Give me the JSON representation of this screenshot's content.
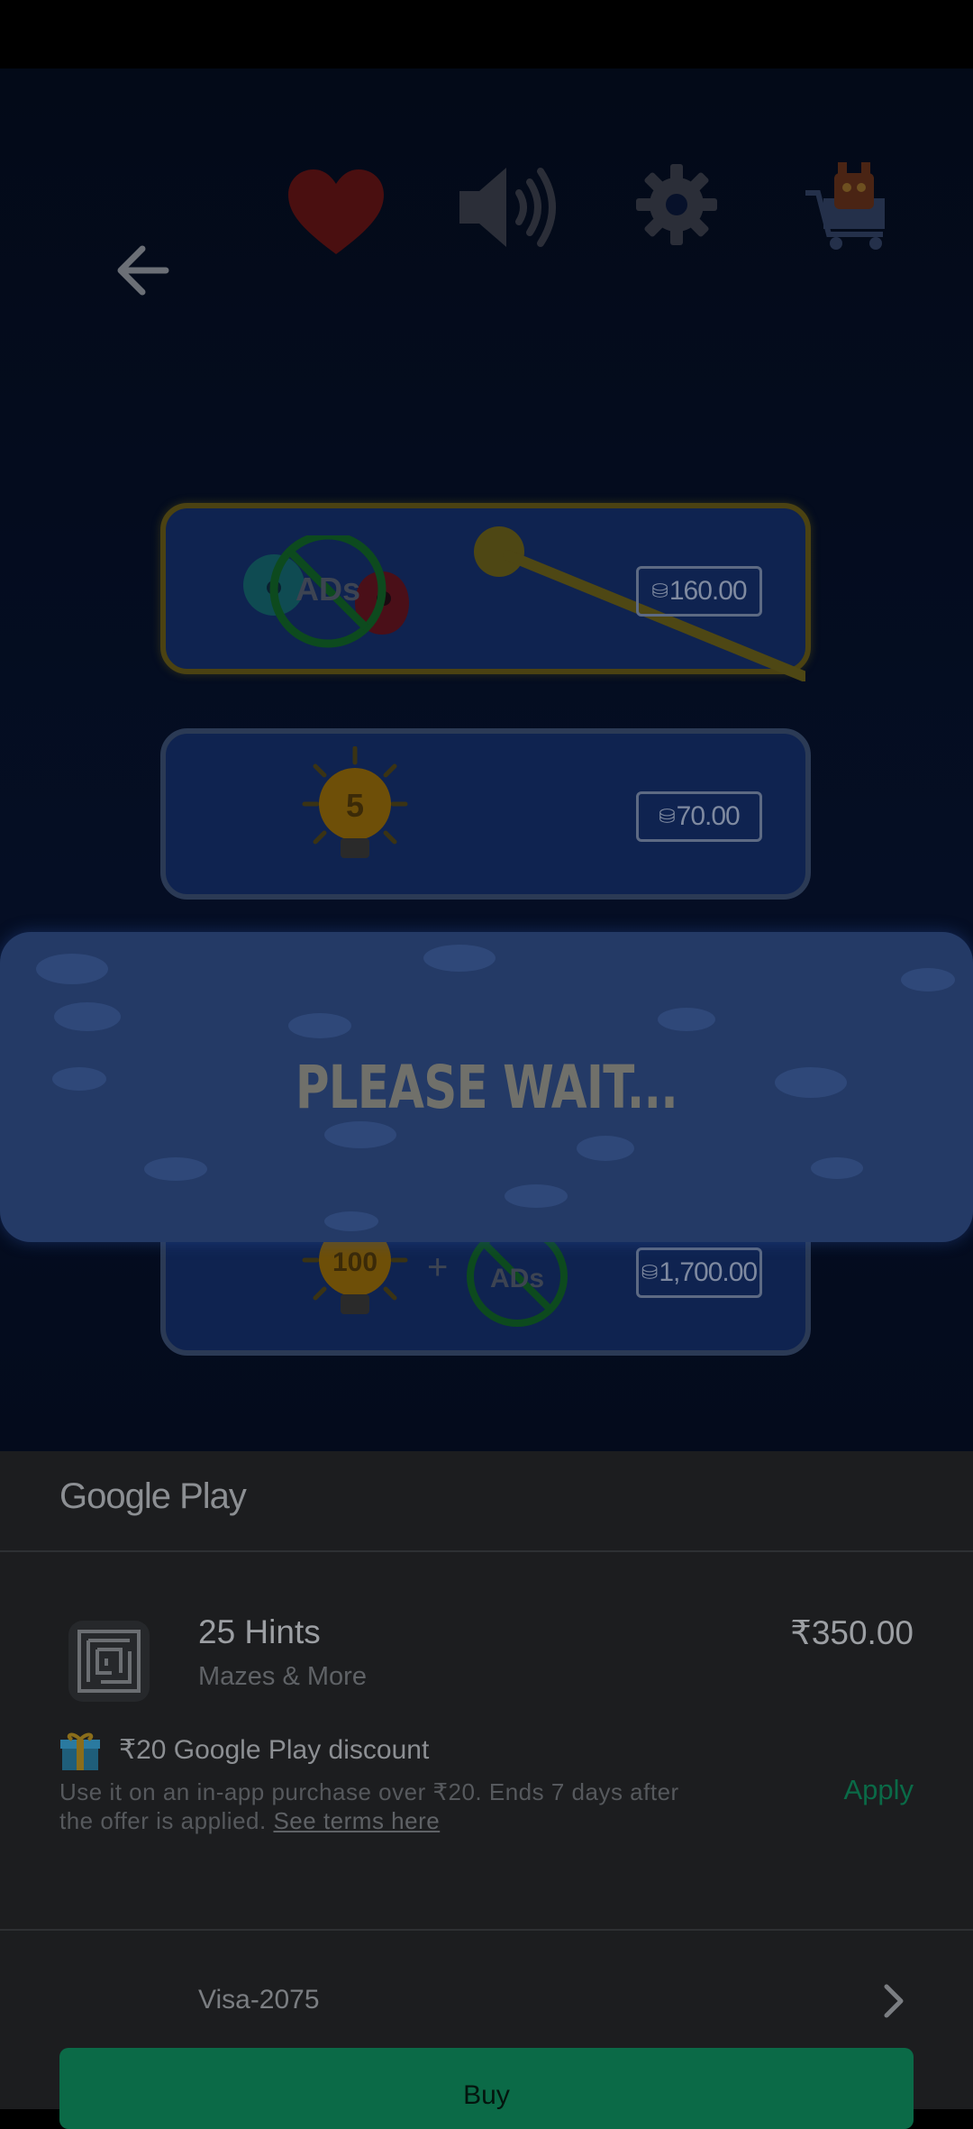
{
  "game": {
    "top_bar": {
      "back_icon": "arrow-left-icon",
      "favorite_icon": "heart-icon",
      "sound_icon": "speaker-icon",
      "settings_icon": "gear-icon",
      "shop_icon": "cart-icon"
    },
    "products": [
      {
        "badge": "ADs",
        "price": "160.00"
      },
      {
        "count": "5",
        "price": "70.00"
      },
      {
        "count": "100",
        "plus": "+",
        "badge": "ADs",
        "price": "1,700.00"
      }
    ],
    "wait_message": "PLEASE WAIT..."
  },
  "purchase_sheet": {
    "brand": "Google Play",
    "item_title": "25 Hints",
    "item_subtitle": "Mazes & More",
    "item_price": "₹350.00",
    "discount_title": "₹20 Google Play discount",
    "discount_description": "Use it on an in-app purchase over ₹20. Ends 7 days after the offer is applied.",
    "terms_link": "See terms here",
    "apply_label": "Apply",
    "payment_method": "Visa-2075",
    "buy_label": "Buy"
  },
  "colors": {
    "banner": "#243a66",
    "apply": "#0a6a47",
    "buy_button": "#0b6a47",
    "sheet_background": "#1c1d1f"
  }
}
